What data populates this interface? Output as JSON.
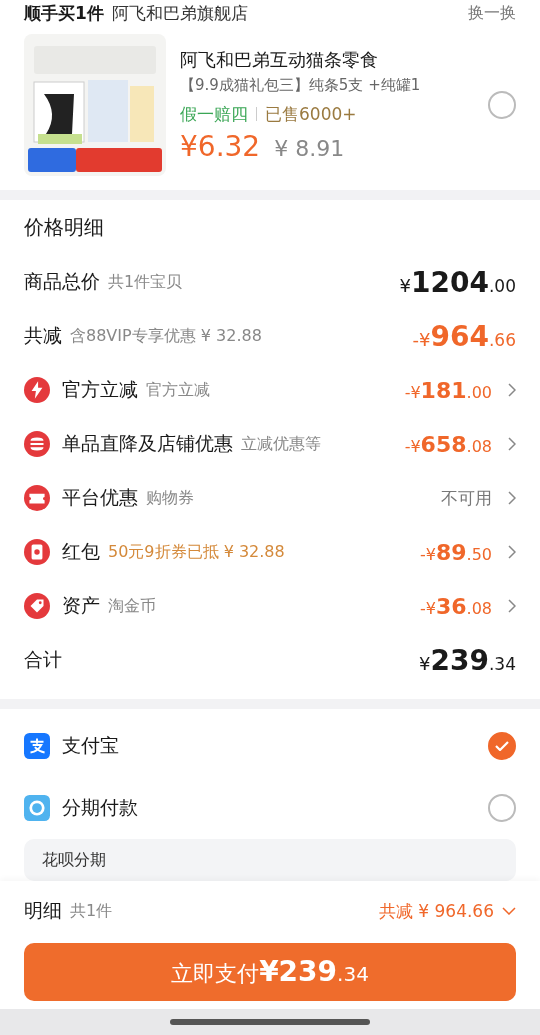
{
  "header": {
    "title": "顺手买1件",
    "store": "阿飞和巴弟旗舰店",
    "refresh": "换一换"
  },
  "product": {
    "kind": "picture",
    "name": "阿飞和巴弟互动猫条零食",
    "spec": "【9.9成猫礼包三】纯条5支 +纯罐1",
    "guarantee": "假一赔四",
    "sold": "已售6000+",
    "price": "¥6.32",
    "original_price": "¥ 8.91",
    "selected": false
  },
  "price_detail": {
    "title": "价格明细",
    "summary": [
      {
        "label": "商品总价",
        "note": "共1件宝贝",
        "amount": "¥1204.00",
        "kind": "total"
      },
      {
        "label": "共减",
        "note": "含88VIP专享优惠 ¥ 32.88",
        "amount": "-¥964.66",
        "kind": "discount"
      }
    ],
    "items": [
      {
        "kind": "bolt",
        "label": "官方立减",
        "note": "官方立减",
        "amount": "-¥181.00",
        "note_highlight": false
      },
      {
        "kind": "shop",
        "label": "单品直降及店铺优惠",
        "note": "立减优惠等",
        "amount": "-¥658.08",
        "note_highlight": false
      },
      {
        "kind": "ticket",
        "label": "平台优惠",
        "note": "购物券",
        "amount": "不可用",
        "note_highlight": false
      },
      {
        "kind": "envelope",
        "label": "红包",
        "note": "50元9折券已抵 ¥ 32.88",
        "amount": "-¥89.50",
        "note_highlight": true
      },
      {
        "kind": "tag",
        "label": "资产",
        "note": "淘金币",
        "amount": "-¥36.08",
        "note_highlight": false
      }
    ],
    "total": {
      "label": "合计",
      "amount": "¥239.34"
    }
  },
  "payment": [
    {
      "kind": "alipay",
      "label": "支付宝",
      "selected": true
    },
    {
      "kind": "installment",
      "label": "分期付款",
      "selected": false
    }
  ],
  "huabei": {
    "label": "花呗分期"
  },
  "footer": {
    "label": "明细",
    "count": "共1件",
    "saving": "共减 ¥ 964.66",
    "pay_button": {
      "label": "立即支付",
      "amount": "¥239.34"
    }
  }
}
